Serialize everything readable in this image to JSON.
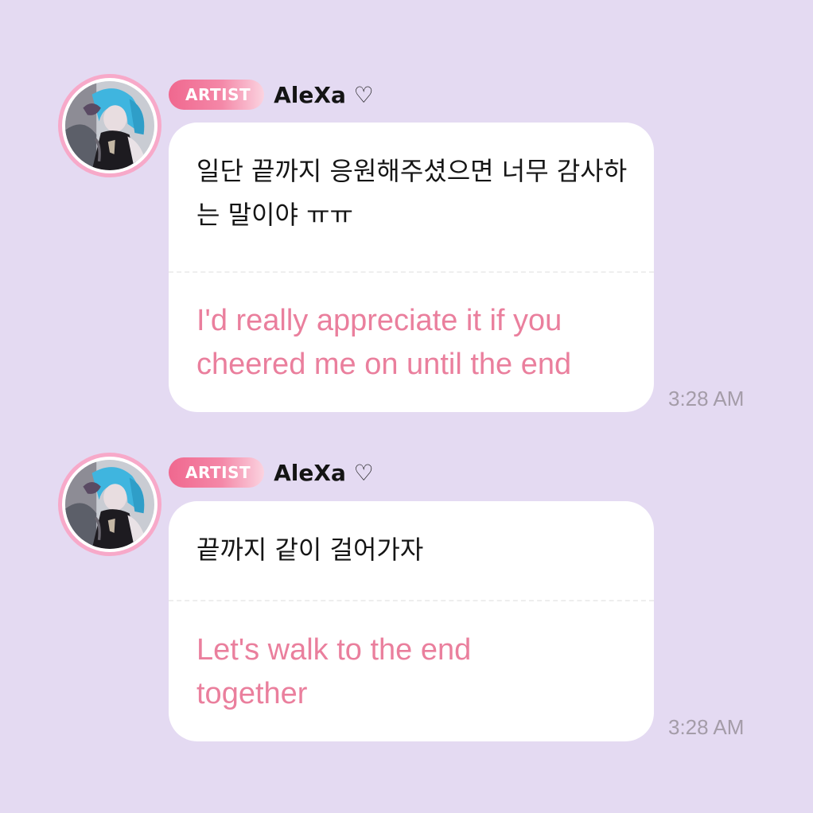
{
  "messages": [
    {
      "badge": "ARTIST",
      "author": "AleXa ♡",
      "original": "일단 끝까지 응원해주셨으면 너무 감사하는 말이야 ㅠㅠ",
      "translation": "I'd really appreciate it if you cheered me on until the end",
      "time": "3:28 AM"
    },
    {
      "badge": "ARTIST",
      "author": "AleXa ♡",
      "original": "끝까지 같이 걸어가자",
      "translation": "Let's walk to the end together",
      "time": "3:28 AM"
    }
  ],
  "colors": {
    "background": "#e4daf2",
    "badge_start": "#f0688f",
    "badge_end": "#fbd3e0",
    "translation_text": "#ea7f9d",
    "timestamp": "#a49ca8",
    "avatar_ring": "#f7a9c9"
  },
  "icons": {
    "avatar": "profile-photo"
  }
}
